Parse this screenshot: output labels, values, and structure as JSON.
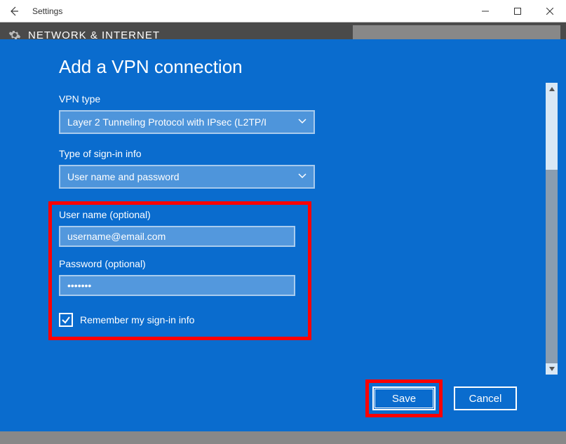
{
  "window": {
    "title": "Settings",
    "section_hint": "NETWORK & INTERNET"
  },
  "page": {
    "title": "Add a VPN connection"
  },
  "vpn_type": {
    "label": "VPN type",
    "value": "Layer 2 Tunneling Protocol with IPsec (L2TP/I"
  },
  "signin_type": {
    "label": "Type of sign-in info",
    "value": "User name and password"
  },
  "username": {
    "label": "User name (optional)",
    "value": "username@email.com"
  },
  "password": {
    "label": "Password (optional)",
    "value": "•••••••"
  },
  "remember": {
    "label": "Remember my sign-in info",
    "checked": true
  },
  "buttons": {
    "save": "Save",
    "cancel": "Cancel"
  }
}
